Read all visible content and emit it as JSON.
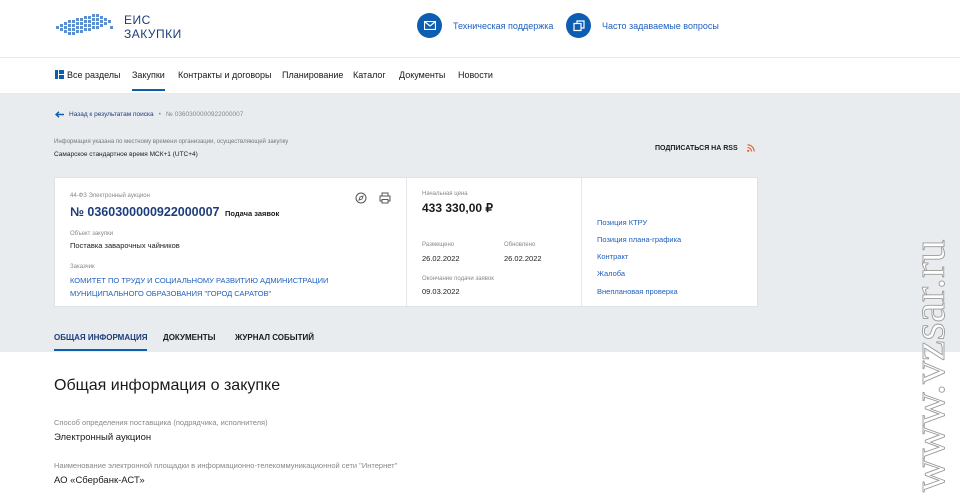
{
  "header": {
    "logo_line1": "ЕИС",
    "logo_line2": "ЗАКУПКИ",
    "support_label": "Техническая поддержка",
    "support_icon": "mail-icon",
    "faq_label": "Часто задаваемые вопросы",
    "faq_icon": "faq-icon",
    "brand_color": "#0d5eb1"
  },
  "nav": {
    "items": [
      "Все разделы",
      "Закупки",
      "Контракты и договоры",
      "Планирование",
      "Каталог",
      "Документы",
      "Новости"
    ],
    "active": "Закупки"
  },
  "breadcrumb": {
    "back": "Назад к результатам поиска",
    "current": "№ 0360300000922000007"
  },
  "timezone": {
    "note": "Информация указана по местному времени организации, осуществляющей закупку",
    "value": "Самарское стандартное время МСК+1 (UTC+4)"
  },
  "rss_label": "ПОДПИСАТЬСЯ НА RSS",
  "card": {
    "law": "44-ФЗ Электронный аукцион",
    "number": "№ 0360300000922000007",
    "stage": "Подача заявок",
    "object_label": "Объект закупки",
    "object_value": "Поставка заварочных чайников",
    "customer_label": "Заказчик",
    "customer_line1": "КОМИТЕТ ПО ТРУДУ И СОЦИАЛЬНОМУ РАЗВИТИЮ АДМИНИСТРАЦИИ",
    "customer_line2": "МУНИЦИПАЛЬНОГО ОБРАЗОВАНИЯ \"ГОРОД САРАТОВ\"",
    "price_label": "Начальная цена",
    "price_value": "433 330,00 ₽",
    "posted_label": "Размещено",
    "posted_value": "26.02.2022",
    "updated_label": "Обновлено",
    "updated_value": "26.02.2022",
    "deadline_label": "Окончание подачи заявок",
    "deadline_value": "09.03.2022",
    "links": [
      "Позиция КТРУ",
      "Позиция плана-графика",
      "Контракт",
      "Жалоба",
      "Внеплановая проверка"
    ]
  },
  "tabs": [
    "ОБЩАЯ ИНФОРМАЦИЯ",
    "ДОКУМЕНТЫ",
    "ЖУРНАЛ СОБЫТИЙ"
  ],
  "main": {
    "title": "Общая информация о закупке",
    "fields": [
      {
        "label": "Способ определения поставщика (подрядчика, исполнителя)",
        "value": "Электронный аукцион"
      },
      {
        "label": "Наименование электронной площадки в информационно-телекоммуникационной сети \"Интернет\"",
        "value": "АО «Сбербанк-АСТ»"
      }
    ]
  },
  "watermark": "www.vzsar.ru"
}
